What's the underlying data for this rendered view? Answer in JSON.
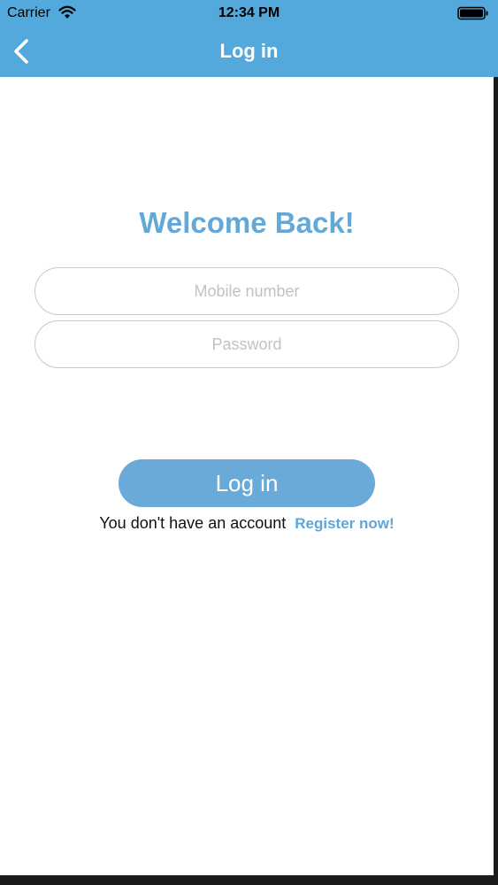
{
  "status_bar": {
    "carrier": "Carrier",
    "time": "12:34 PM",
    "wifi_icon": "wifi-icon",
    "battery_icon": "battery-icon"
  },
  "nav": {
    "back_icon": "chevron-left-icon",
    "title": "Log in",
    "background_color": "#53a9dc"
  },
  "form": {
    "heading": "Welcome Back!",
    "mobile_placeholder": "Mobile number",
    "mobile_value": "",
    "password_placeholder": "Password",
    "password_value": "",
    "login_label": "Log in",
    "no_account_text": "You don't have an account",
    "register_label": "Register now!"
  },
  "colors": {
    "accent": "#6aaad9",
    "heading": "#64a8d8",
    "link": "#5fa5d6"
  }
}
